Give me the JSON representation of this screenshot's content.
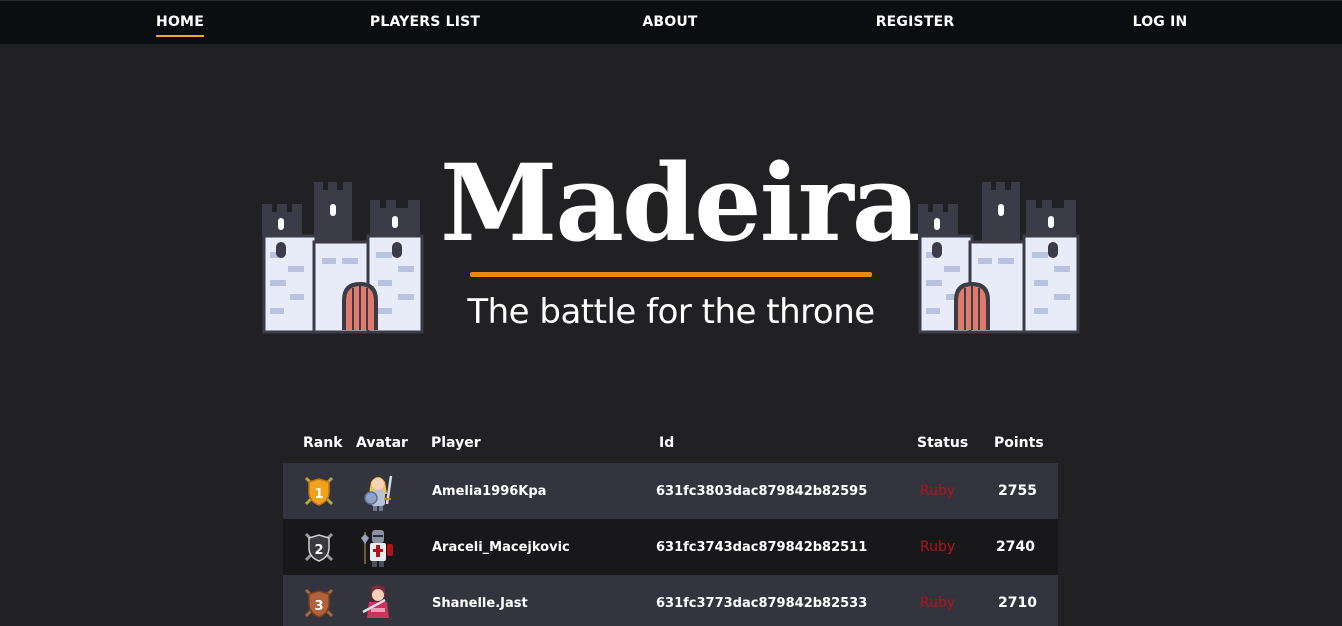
{
  "nav": {
    "items": [
      {
        "label": "HOME",
        "active": true
      },
      {
        "label": "PLAYERS LIST",
        "active": false
      },
      {
        "label": "ABOUT",
        "active": false
      },
      {
        "label": "REGISTER",
        "active": false
      },
      {
        "label": "LOG IN",
        "active": false
      }
    ],
    "accent_color": "#f5a623"
  },
  "hero": {
    "title": "Madeira",
    "subtitle": "The battle for the throne",
    "bar_color": "#e8890c"
  },
  "table": {
    "headers": {
      "rank": "Rank",
      "avatar": "Avatar",
      "player": "Player",
      "id": "Id",
      "status": "Status",
      "points": "Points"
    },
    "rows": [
      {
        "rank": "1",
        "badge": "gold-rank-badge-icon",
        "avatar": "female-knight-avatar-icon",
        "player": "Amelia1996Kpa",
        "id": "631fc3803dac879842b82595",
        "status": "Ruby",
        "points": "2755"
      },
      {
        "rank": "2",
        "badge": "silver-rank-badge-icon",
        "avatar": "templar-knight-avatar-icon",
        "player": "Araceli_Macejkovic",
        "id": "631fc3743dac879842b82511",
        "status": "Ruby",
        "points": "2740"
      },
      {
        "rank": "3",
        "badge": "bronze-rank-badge-icon",
        "avatar": "female-warrior-avatar-icon",
        "player": "Shanelle.Jast",
        "id": "631fc3773dac879842b82533",
        "status": "Ruby",
        "points": "2710"
      }
    ],
    "status_color": "#b3121a"
  }
}
